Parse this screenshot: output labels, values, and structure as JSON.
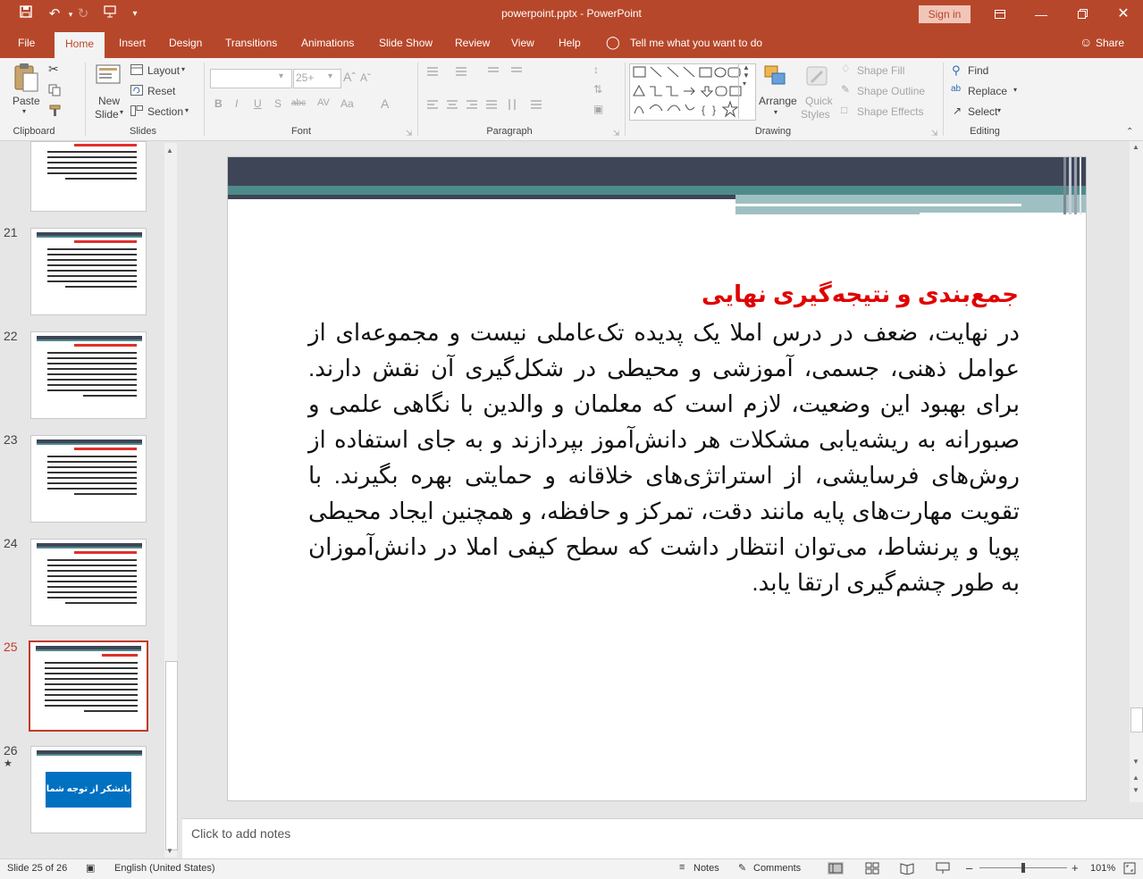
{
  "window": {
    "title": "powerpoint.pptx  -  PowerPoint",
    "sign_in": "Sign in"
  },
  "tabs": [
    {
      "label": "File"
    },
    {
      "label": "Home"
    },
    {
      "label": "Insert"
    },
    {
      "label": "Design"
    },
    {
      "label": "Transitions"
    },
    {
      "label": "Animations"
    },
    {
      "label": "Slide Show"
    },
    {
      "label": "Review"
    },
    {
      "label": "View"
    },
    {
      "label": "Help"
    }
  ],
  "tell_me": "Tell me what you want to do",
  "share": "Share",
  "ribbon": {
    "clipboard": {
      "paste": "Paste",
      "label": "Clipboard"
    },
    "slides": {
      "new_slide_1": "New",
      "new_slide_2": "Slide",
      "layout": "Layout",
      "reset": "Reset",
      "section": "Section",
      "label": "Slides"
    },
    "font": {
      "size": "25+",
      "label": "Font"
    },
    "paragraph": {
      "label": "Paragraph"
    },
    "drawing": {
      "arrange": "Arrange",
      "quick_styles_1": "Quick",
      "quick_styles_2": "Styles",
      "shape_fill": "Shape Fill",
      "shape_outline": "Shape Outline",
      "shape_effects": "Shape Effects",
      "label": "Drawing"
    },
    "editing": {
      "find": "Find",
      "replace": "Replace",
      "select": "Select",
      "label": "Editing"
    }
  },
  "thumbnails": [
    {
      "num": "21"
    },
    {
      "num": "22"
    },
    {
      "num": "23"
    },
    {
      "num": "24"
    },
    {
      "num": "25"
    },
    {
      "num": "26"
    }
  ],
  "last_thumb_text": "باتشکر از توجه شما",
  "slide": {
    "title": "جمع‌بندی و نتیجه‌گیری نهایی",
    "body": "در نهایت، ضعف در درس املا یک پدیده تک‌عاملی نیست و مجموعه‌ای از عوامل ذهنی، جسمی، آموزشی و محیطی در شکل‌گیری آن نقش دارند. برای بهبود این وضعیت، لازم است که معلمان و والدین با نگاهی علمی و صبورانه به ریشه‌یابی مشکلات هر دانش‌آموز بپردازند و به جای استفاده از روش‌های فرسایشی، از استراتژی‌های خلاقانه و حمایتی بهره بگیرند. با تقویت مهارت‌های پایه مانند دقت، تمرکز و حافظه، و همچنین ایجاد محیطی پویا و پرنشاط، می‌توان انتظار داشت که سطح کیفی املا در دانش‌آموزان به طور چشم‌گیری ارتقا یابد."
  },
  "notes_placeholder": "Click to add notes",
  "status": {
    "slide_of": "Slide 25 of 26",
    "language": "English (United States)",
    "notes": "Notes",
    "comments": "Comments",
    "zoom": "101%"
  },
  "colors": {
    "accent": "#b7472a",
    "title_red": "#e00000",
    "header_dark": "#3e4557",
    "header_teal": "#4f8a8b"
  }
}
